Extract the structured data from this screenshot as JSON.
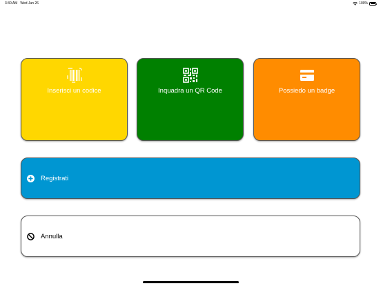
{
  "status_bar": {
    "time": "3:30 AM",
    "date": "Wed Jun 26",
    "battery": "100%"
  },
  "options": {
    "code": {
      "label": "Inserisci un codice",
      "icon": "barcode-icon",
      "color": "#FFD700"
    },
    "qr": {
      "label": "Inquadra un QR Code",
      "icon": "qr-code-icon",
      "color": "#008000"
    },
    "badge": {
      "label": "Possiedo un badge",
      "icon": "card-icon",
      "color": "#FF8C00"
    }
  },
  "actions": {
    "register": {
      "label": "Registrati",
      "icon": "plus-circle-icon",
      "color": "#0096D2"
    },
    "cancel": {
      "label": "Annulla",
      "icon": "prohibited-icon",
      "color": "#FFFFFF"
    }
  }
}
